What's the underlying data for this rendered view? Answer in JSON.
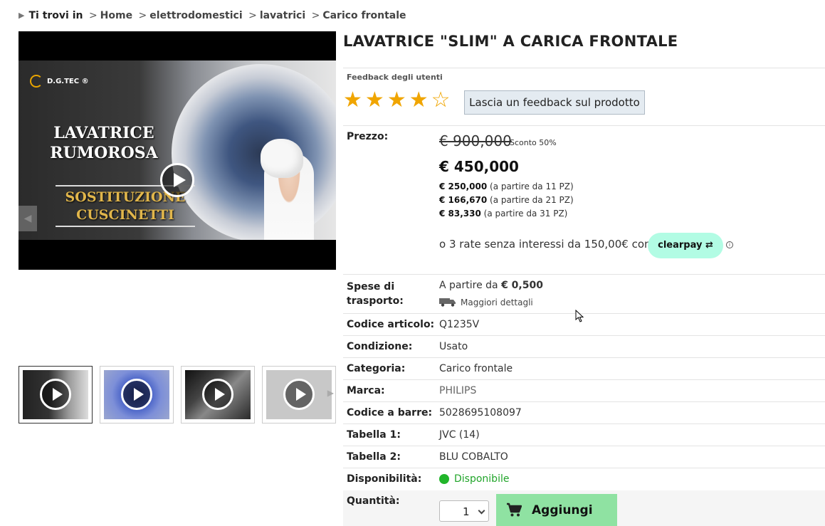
{
  "breadcrumb": {
    "prefix": "Ti trovi in",
    "items": [
      "Home",
      "elettrodomestici",
      "lavatrici",
      "Carico frontale"
    ],
    "separator": ">"
  },
  "video": {
    "brand": "D.G.TEC ®",
    "headline": "LAVATRICE RUMOROSA",
    "subheadline": "SOSTITUZIONE CUSCINETTI"
  },
  "product": {
    "title": "LAVATRICE \"SLIM\" A CARICA FRONTALE",
    "feedback_label": "Feedback degli utenti",
    "rating": 4,
    "rating_max": 5,
    "feedback_button": "Lascia un feedback sul prodotto"
  },
  "price": {
    "label": "Prezzo:",
    "old": "€ 900,000",
    "discount": "Sconto 50%",
    "current": "€ 450,000",
    "tiers": [
      {
        "price": "€ 250,000",
        "note": "(a partire da 11 PZ)"
      },
      {
        "price": "€ 166,670",
        "note": "(a partire da 21 PZ)"
      },
      {
        "price": "€ 83,330",
        "note": "(a partire da 31 PZ)"
      }
    ],
    "installments": "o 3 rate senza interessi da 150,00€ con",
    "clearpay": "clearpay",
    "info_icon": "info-icon"
  },
  "shipping": {
    "label_line1": "Spese di",
    "label_line2": "trasporto:",
    "value_prefix": "A partire da",
    "value_amount": "€ 0,500",
    "details_link": "Maggiori dettagli"
  },
  "specs": [
    {
      "label": "Codice articolo:",
      "value": "Q1235V"
    },
    {
      "label": "Condizione:",
      "value": "Usato"
    },
    {
      "label": "Categoria:",
      "value": "Carico frontale"
    },
    {
      "label": "Marca:",
      "value": "PHILIPS"
    },
    {
      "label": "Codice a barre:",
      "value": "5028695108097"
    },
    {
      "label": "Tabella 1:",
      "value": "JVC (14)"
    },
    {
      "label": "Tabella 2:",
      "value": "BLU COBALTO"
    }
  ],
  "availability": {
    "label": "Disponibilità:",
    "value": "Disponibile",
    "color": "#21b52a"
  },
  "quantity": {
    "label": "Quantità:",
    "value": "1"
  },
  "cart": {
    "button": "Aggiungi",
    "color": "#8fe2a2"
  },
  "colors": {
    "star": "#f0a500",
    "clearpay": "#b2fce4",
    "feedback_button_bg": "#e4ebf1"
  }
}
